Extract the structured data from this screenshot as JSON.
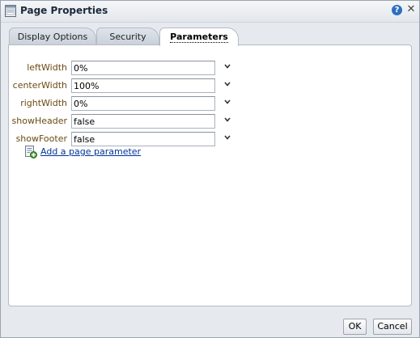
{
  "window": {
    "title": "Page Properties",
    "icon": "page-properties-icon"
  },
  "titlebar": {
    "help_icon": "help-icon",
    "close_icon": "close-icon",
    "help_glyph": "?",
    "close_glyph": "✕"
  },
  "tabs": [
    {
      "label": "Display Options",
      "active": false
    },
    {
      "label": "Security",
      "active": false
    },
    {
      "label": "Parameters",
      "active": true
    }
  ],
  "parameters": [
    {
      "label": "leftWidth",
      "value": "0%"
    },
    {
      "label": "centerWidth",
      "value": "100%"
    },
    {
      "label": "rightWidth",
      "value": "0%"
    },
    {
      "label": "showHeader",
      "value": "false"
    },
    {
      "label": "showFooter",
      "value": "false"
    }
  ],
  "add_parameter": {
    "label": "Add a page parameter",
    "icon": "add-parameter-icon"
  },
  "footer": {
    "ok_label": "OK",
    "cancel_label": "Cancel"
  },
  "colors": {
    "label_text": "#6b4a12",
    "link": "#003399",
    "help_icon_bg": "#2f6fc0"
  }
}
